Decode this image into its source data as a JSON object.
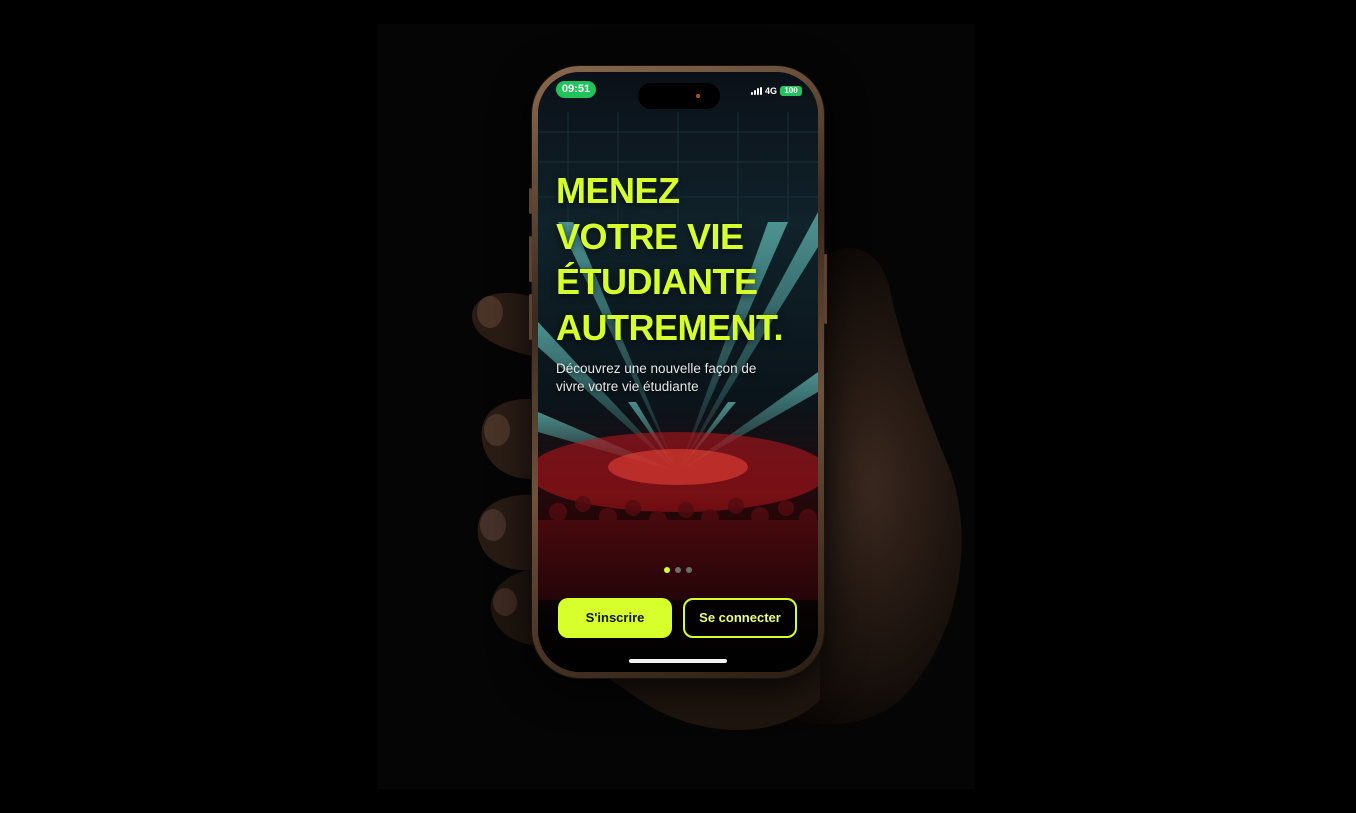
{
  "status_bar": {
    "time": "09:51",
    "network": "4G",
    "battery": "100"
  },
  "hero": {
    "headline_lines": [
      "MENEZ",
      "VOTRE VIE",
      "ÉTUDIANTE",
      "AUTREMENT."
    ],
    "subtitle": "Découvrez une nouvelle façon de vivre votre vie étudiante"
  },
  "pager": {
    "total": 3,
    "active_index": 0
  },
  "actions": {
    "signup_label": "S'inscrire",
    "login_label": "Se connecter"
  },
  "colors": {
    "accent": "#d7ff2b",
    "status_green": "#21c45a",
    "background": "#000000"
  },
  "icons": [
    "signal-icon",
    "battery-icon",
    "camera-icon"
  ]
}
